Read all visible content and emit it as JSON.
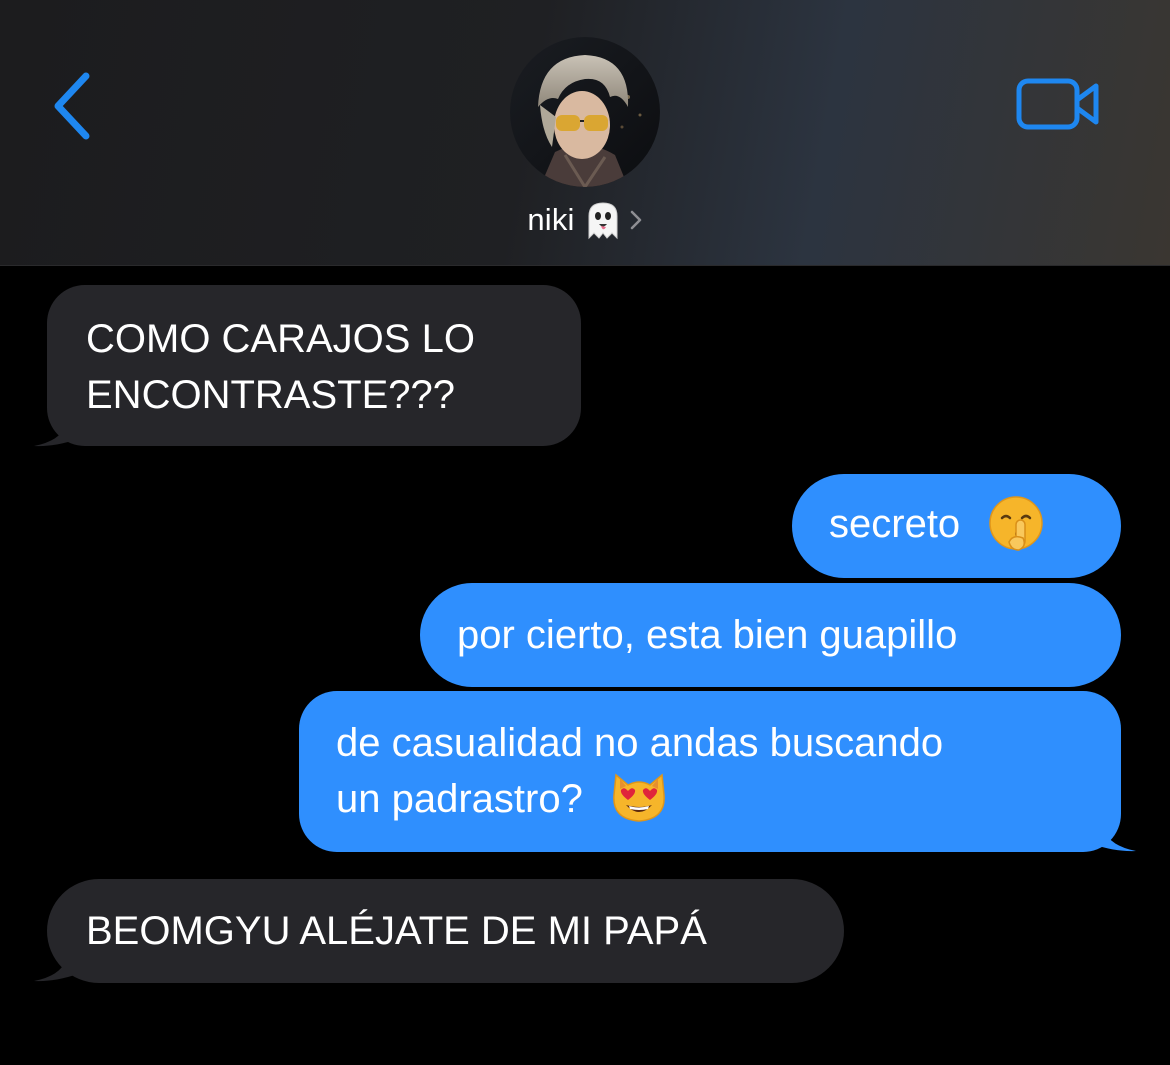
{
  "header": {
    "contact_name": "niki",
    "name_emoji": "ghost-icon",
    "back_icon": "chevron-left-icon",
    "video_icon": "video-camera-icon",
    "accent_color": "#1e87f0"
  },
  "messages": [
    {
      "direction": "incoming",
      "text": "COMO CARAJOS LO ENCONTRASTE???",
      "lines": [
        "COMO CARAJOS LO",
        "ENCONTRASTE???"
      ]
    },
    {
      "direction": "outgoing",
      "text": "secreto",
      "emoji": "shushing-face-icon"
    },
    {
      "direction": "outgoing",
      "text": "por cierto, esta bien guapillo"
    },
    {
      "direction": "outgoing",
      "lines": [
        "de casualidad no andas buscando",
        "un padrastro?"
      ],
      "emoji": "heart-eyes-cat-icon"
    },
    {
      "direction": "incoming",
      "text": "BEOMGYU ALÉJATE DE MI PAPÁ"
    }
  ],
  "colors": {
    "incoming_bubble": "#26262a",
    "outgoing_bubble": "#2f8ffe",
    "background": "#000000"
  }
}
